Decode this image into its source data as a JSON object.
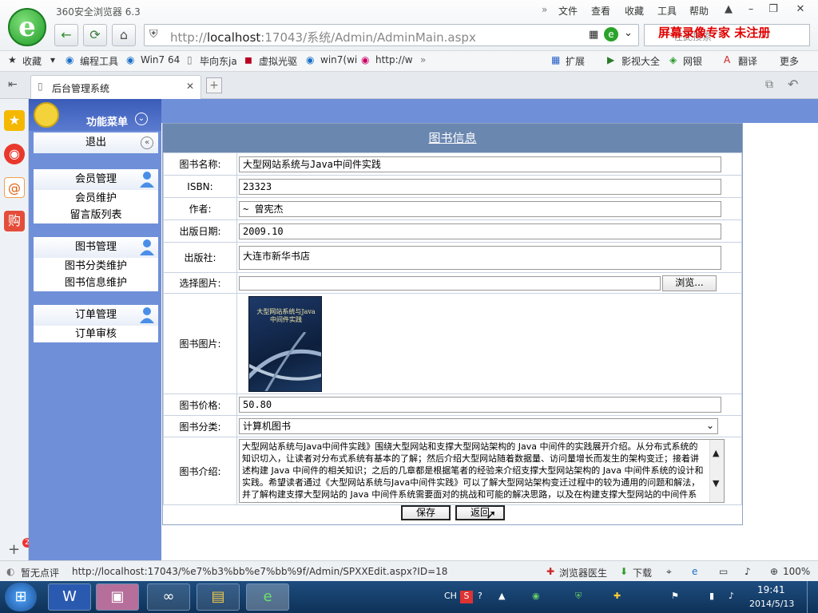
{
  "browser": {
    "title": "360安全浏览器 6.3",
    "menu": [
      "文件",
      "查看",
      "收藏",
      "工具",
      "帮助"
    ],
    "address": {
      "prefix": "http://",
      "host": "localhost",
      "rest": ":17043/系统/Admin/AdminMain.aspx"
    },
    "search_placeholder": "在此搜索",
    "watermark": "屏幕录像专家  未注册",
    "favorites": [
      "收藏",
      "编程工具",
      "Win7 64",
      "毕向东ja",
      "虚拟光驱",
      "win7(wi",
      "http://w"
    ],
    "right_tools": [
      "扩展",
      "影视大全",
      "网银",
      "翻译",
      "更多"
    ],
    "tab_title": "后台管理系统"
  },
  "sidebar": {
    "menu_title": "功能菜单",
    "logout": "退出",
    "groups": [
      {
        "title": "会员管理",
        "items": [
          "会员维护",
          "留言版列表"
        ]
      },
      {
        "title": "图书管理",
        "items": [
          "图书分类维护",
          "图书信息维护"
        ]
      },
      {
        "title": "订单管理",
        "items": [
          "订单审核"
        ]
      }
    ]
  },
  "form": {
    "title": "图书信息",
    "fields": {
      "name": {
        "label": "图书名称:",
        "value": "大型网站系统与Java中间件实践"
      },
      "isbn": {
        "label": "ISBN:",
        "value": "23323"
      },
      "author": {
        "label": "作者:",
        "value": "~ 曾宪杰"
      },
      "date": {
        "label": "出版日期:",
        "value": "2009.10"
      },
      "publisher": {
        "label": "出版社:",
        "value": "大连市新华书店"
      },
      "image_select": {
        "label": "选择图片:",
        "browse": "浏览..."
      },
      "image": {
        "label": "图书图片:",
        "cover_text": "大型网站系统与Java中间件实践"
      },
      "price": {
        "label": "图书价格:",
        "value": "50.80"
      },
      "category": {
        "label": "图书分类:",
        "value": "计算机图书"
      },
      "intro": {
        "label": "图书介绍:",
        "value": "大型网站系统与Java中间件实践》围绕大型网站和支撑大型网站架构的 Java 中间件的实践展开介绍。从分布式系统的知识切入，让读者对分布式系统有基本的了解；然后介绍大型网站随着数据量、访问量增长而发生的架构变迁；接着讲述构建 Java 中间件的相关知识；之后的几章都是根据笔者的经验来介绍支撑大型网站架构的 Java 中间件系统的设计和实践。希望读者通过《大型网站系统与Java中间件实践》可以了解大型网站架构变迁过程中的较为通用的问题和解法，并了解构建支撑大型网站的 Java 中间件系统需要面对的挑战和可能的解决思路，以及在构建支撑大型网站的中间件系统时所需要的相关知识。"
      }
    },
    "save": "保存",
    "back": "返回"
  },
  "status": {
    "left": "暂无点评",
    "url": "http://localhost:17043/%e7%b3%bb%e7%bb%9f/Admin/SPXXEdit.aspx?ID=18",
    "doctor": "浏览器医生",
    "download": "下载",
    "zoom": "100%"
  },
  "taskbar": {
    "ime": "CH",
    "time": "19:41",
    "date": "2014/5/13",
    "badge": "2"
  }
}
